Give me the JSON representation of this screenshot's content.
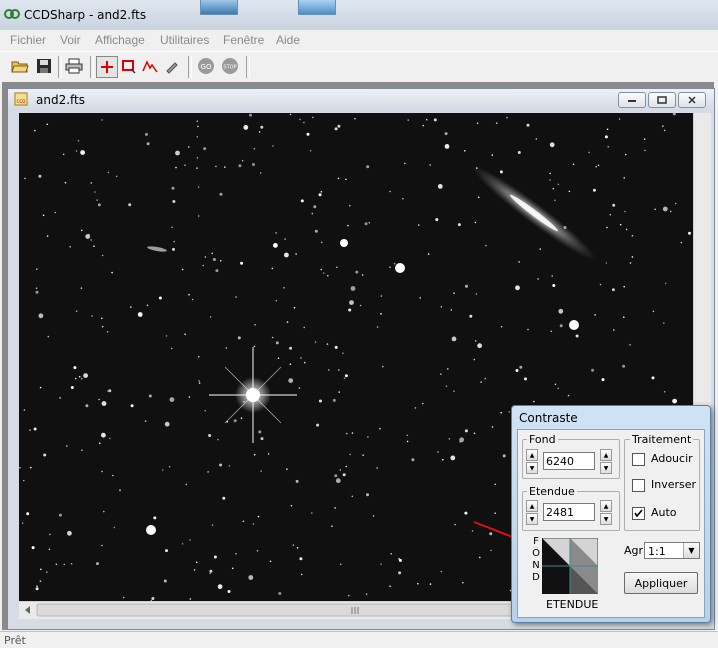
{
  "app": {
    "title": "CCDSharp - and2.fts"
  },
  "menu": [
    "Fichier",
    "Voir",
    "Affichage",
    "Utilitaires",
    "Fenêtre",
    "Aide"
  ],
  "child_window": {
    "title": "and2.fts"
  },
  "status": {
    "text": "Prêt"
  },
  "dialog": {
    "title": "Contraste",
    "fond_label": "Fond",
    "fond_value": "6240",
    "etendue_label": "Etendue",
    "etendue_value": "2481",
    "traitement_label": "Traitement",
    "adoucir_label": "Adoucir",
    "adoucir_checked": false,
    "inverser_label": "Inverser",
    "inverser_checked": false,
    "auto_label": "Auto",
    "auto_checked": true,
    "fond_vertical": "FOND",
    "etendue_caption": "ETENDUE",
    "agr_label": "Agr",
    "agr_value": "1:1",
    "apply_label": "Appliquer"
  },
  "colors": {
    "sky": "#111111",
    "arrow": "#e01010",
    "dialog_frame": "#b7d1ea"
  },
  "icons": {
    "toolbar": [
      "open-folder-icon",
      "save-icon",
      "print-icon",
      "crosshair-icon",
      "rectangle-select-icon",
      "profile-icon",
      "brush-icon",
      "go-icon",
      "stop-icon"
    ]
  }
}
